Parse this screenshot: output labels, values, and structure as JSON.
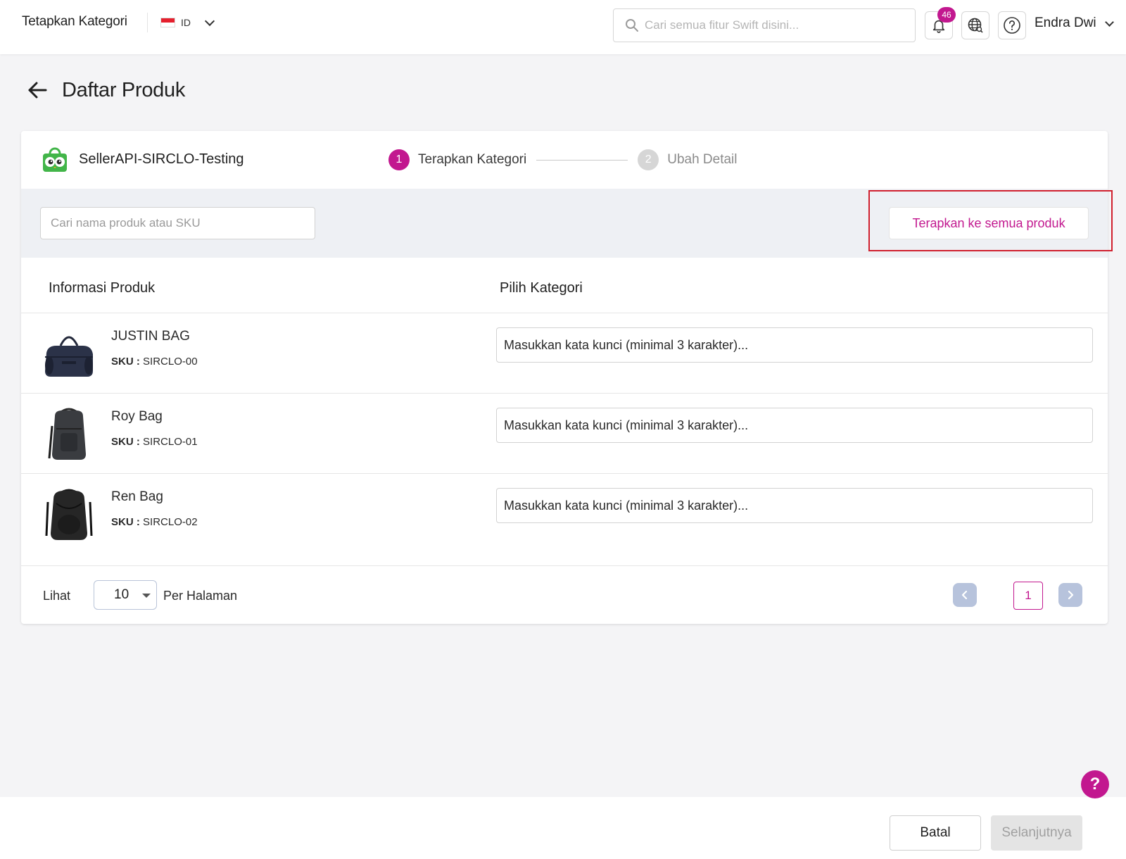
{
  "header": {
    "app_title": "Tetapkan Kategori",
    "language_code": "ID",
    "search_placeholder": "Cari semua fitur Swift disini...",
    "notification_count": "46",
    "user_name": "Endra Dwi"
  },
  "page": {
    "title": "Daftar Produk"
  },
  "store": {
    "name": "SellerAPI-SIRCLO-Testing"
  },
  "stepper": {
    "steps": [
      {
        "number": "1",
        "label": "Terapkan Kategori",
        "active": true
      },
      {
        "number": "2",
        "label": "Ubah Detail",
        "active": false
      }
    ]
  },
  "filter": {
    "search_placeholder": "Cari nama produk atau SKU",
    "apply_all_label": "Terapkan ke semua produk"
  },
  "table": {
    "columns": [
      "Informasi Produk",
      "Pilih Kategori"
    ],
    "sku_label": "SKU :",
    "category_placeholder": "Masukkan kata kunci (minimal 3 karakter)...",
    "rows": [
      {
        "name": "JUSTIN BAG",
        "sku": "SIRCLO-00",
        "icon": "duffel-bag-image"
      },
      {
        "name": "Roy Bag",
        "sku": "SIRCLO-01",
        "icon": "backpack-image"
      },
      {
        "name": "Ren Bag",
        "sku": "SIRCLO-02",
        "icon": "backpack-image"
      }
    ]
  },
  "pagination": {
    "show_label": "Lihat",
    "per_page_value": "10",
    "per_page_label": "Per Halaman",
    "current_page": "1"
  },
  "actions": {
    "cancel_label": "Batal",
    "next_label": "Selanjutnya"
  },
  "help": {
    "label": "?"
  },
  "colors": {
    "accent": "#c2188f",
    "highlight_outline": "#d0202e",
    "disabled_bg": "#e4e4e4"
  }
}
